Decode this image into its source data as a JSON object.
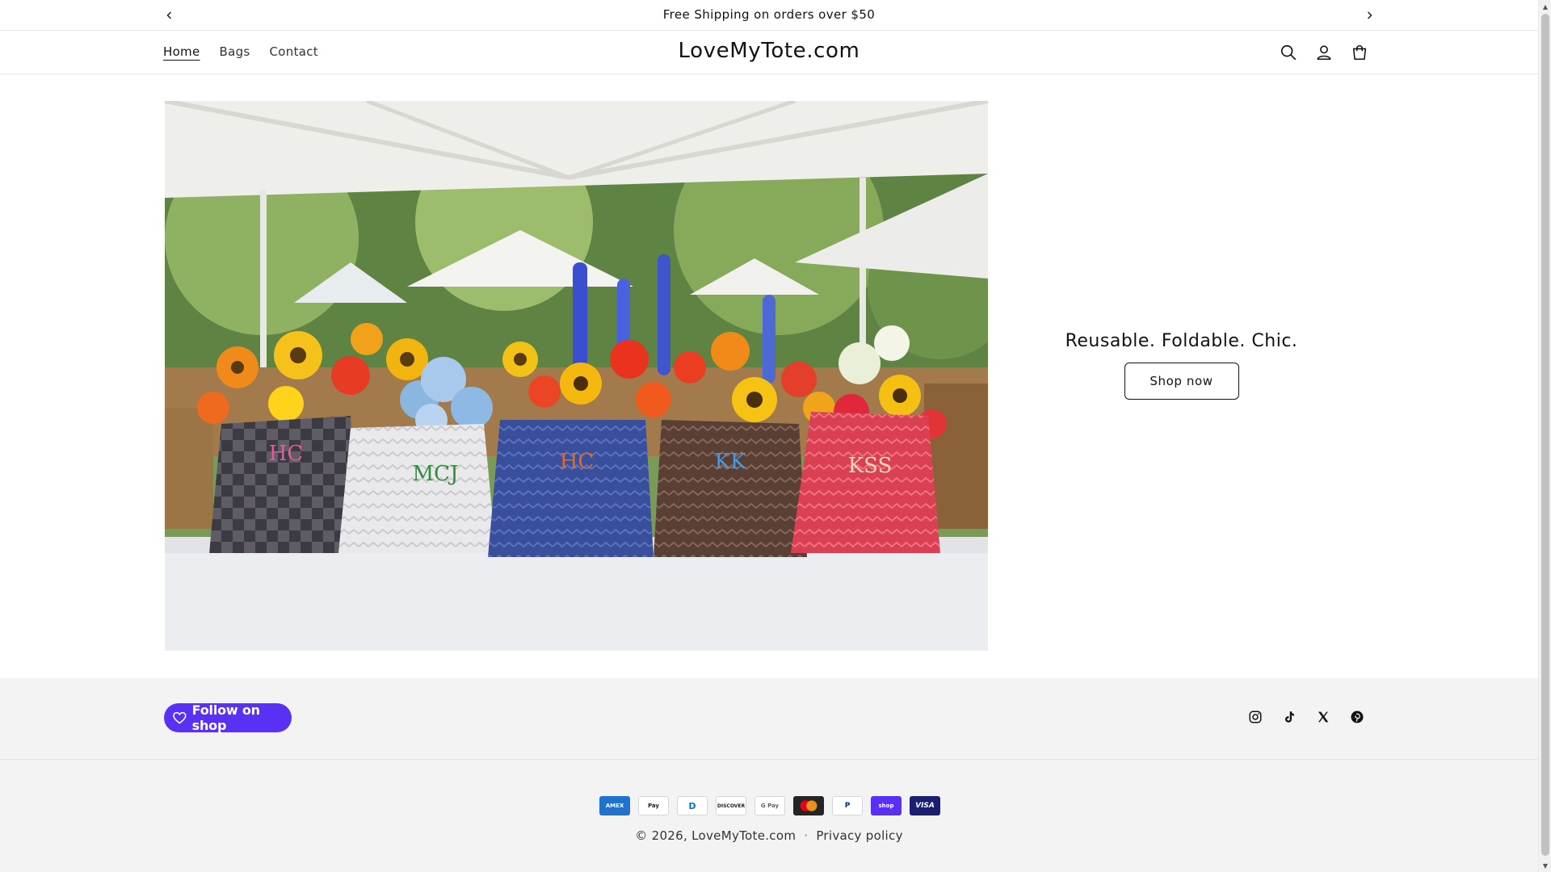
{
  "announcement": {
    "message": "Free Shipping on orders over $50",
    "prev_icon": "chevron-left-icon",
    "next_icon": "chevron-right-icon"
  },
  "header": {
    "nav": [
      {
        "label": "Home",
        "active": true
      },
      {
        "label": "Bags",
        "active": false
      },
      {
        "label": "Contact",
        "active": false
      }
    ],
    "logo": "LoveMyTote.com",
    "icons": [
      "search-icon",
      "account-icon",
      "cart-icon"
    ]
  },
  "hero": {
    "image_alt": "",
    "bag_monograms": [
      "HC",
      "MCJ",
      "HC",
      "KK",
      "KSS"
    ],
    "tagline": "Reusable. Foldable. Chic.",
    "cta_label": "Shop now"
  },
  "footer": {
    "follow_label": "Follow on shop",
    "socials": [
      "instagram-icon",
      "tiktok-icon",
      "x-icon",
      "pinterest-icon"
    ],
    "payment_methods": [
      {
        "label": "AMEX",
        "icon": "amex-icon"
      },
      {
        "label": "Pay",
        "icon": "apple-pay-icon"
      },
      {
        "label": "D",
        "icon": "diners-club-icon"
      },
      {
        "label": "DISCOVER",
        "icon": "discover-icon"
      },
      {
        "label": "G Pay",
        "icon": "google-pay-icon"
      },
      {
        "label": "",
        "icon": "mastercard-icon"
      },
      {
        "label": "P",
        "icon": "paypal-icon"
      },
      {
        "label": "shop",
        "icon": "shop-pay-icon"
      },
      {
        "label": "VISA",
        "icon": "visa-icon"
      }
    ],
    "copyright": "© 2026, LoveMyTote.com",
    "privacy_label": "Privacy policy"
  },
  "colors": {
    "shop_purple": "#5a31f4",
    "text": "#121212",
    "footer_bg": "#f3f3f3"
  }
}
